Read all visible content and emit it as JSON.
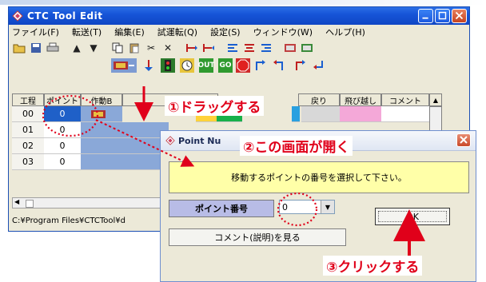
{
  "window": {
    "title": "CTC Tool  Edit",
    "menu": [
      "ファイル(F)",
      "転送(T)",
      "編集(E)",
      "試運転(Q)",
      "設定(S)",
      "ウィンドウ(W)",
      "ヘルプ(H)"
    ]
  },
  "grid": {
    "headers": [
      "工程",
      "ポイント",
      "作動B",
      "",
      "",
      "",
      "",
      "",
      "",
      "戻り",
      "飛び越し",
      "コメント"
    ],
    "rows": [
      {
        "step": "00",
        "point": "0"
      },
      {
        "step": "01",
        "point": "0"
      },
      {
        "step": "02",
        "point": "0"
      },
      {
        "step": "03",
        "point": "0"
      }
    ]
  },
  "status": {
    "path": "C:¥Program Files¥CTCTool¥d"
  },
  "dialog": {
    "title": "Point Nu",
    "message": "移動するポイントの番号を選択して下さい。",
    "point_label": "ポイント番号",
    "point_value": "0",
    "ok_label": "OK",
    "comment_button": "コメント(説明)を見る"
  },
  "annotations": {
    "step1": "①ドラッグする",
    "step2": "②この画面が開く",
    "step3": "③クリックする"
  },
  "colors": {
    "annotation": "#e0001a",
    "titlebar": "#1654d8",
    "message_bg": "#ffffa8"
  }
}
